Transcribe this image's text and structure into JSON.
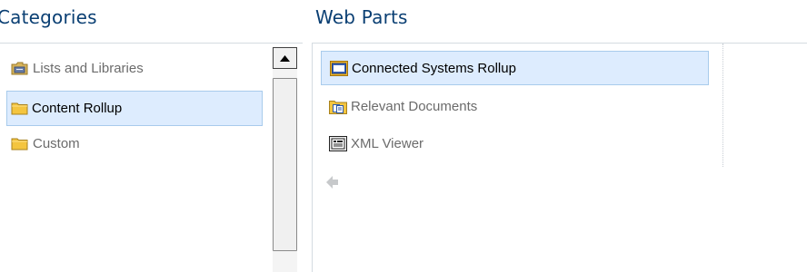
{
  "categories": {
    "heading": "Categories",
    "items": [
      {
        "label": "Lists and Libraries",
        "icon": "library-folder-icon",
        "selected": false
      },
      {
        "label": "Content Rollup",
        "icon": "folder-icon",
        "selected": true
      },
      {
        "label": "Custom",
        "icon": "folder-icon",
        "selected": false
      }
    ]
  },
  "web_parts": {
    "heading": "Web Parts",
    "items": [
      {
        "label": "Connected Systems Rollup",
        "icon": "window-icon",
        "selected": true
      },
      {
        "label": "Relevant Documents",
        "icon": "documents-icon",
        "selected": false
      },
      {
        "label": "XML Viewer",
        "icon": "xml-viewer-icon",
        "selected": false
      }
    ]
  },
  "colors": {
    "heading": "#0a3f73",
    "selection_fill": "#ddecfe",
    "selection_border": "#a8cbec",
    "folder": "#f4c53f"
  }
}
